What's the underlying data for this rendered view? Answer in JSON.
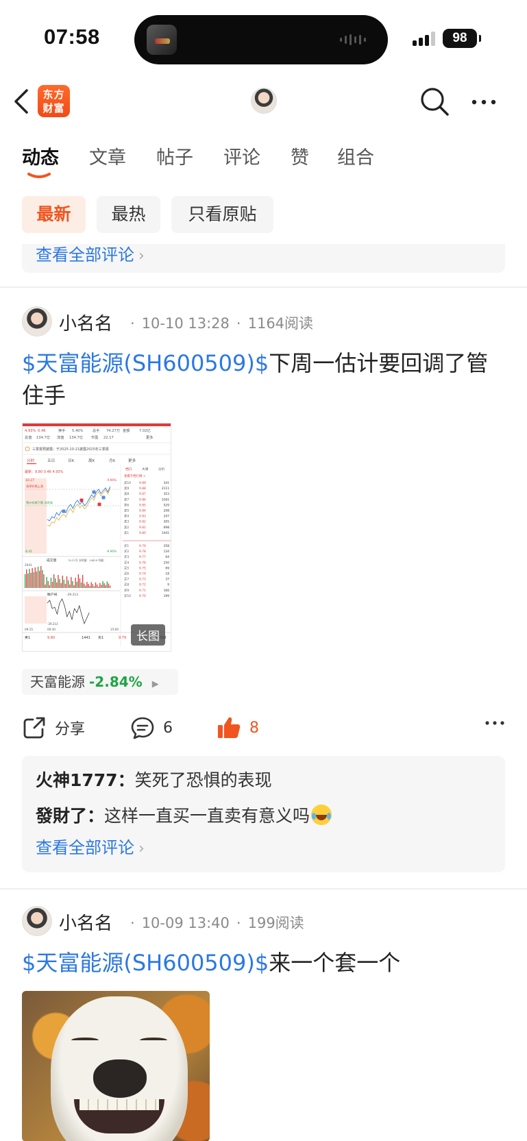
{
  "status_bar": {
    "time": "07:58",
    "battery": "98"
  },
  "nav": {
    "logo_line1": "东方",
    "logo_line2": "财富"
  },
  "tabs": [
    {
      "label": "动态",
      "active": true
    },
    {
      "label": "文章",
      "active": false
    },
    {
      "label": "帖子",
      "active": false
    },
    {
      "label": "评论",
      "active": false
    },
    {
      "label": "赞",
      "active": false
    },
    {
      "label": "组合",
      "active": false
    }
  ],
  "filters": [
    {
      "label": "最新",
      "active": true
    },
    {
      "label": "最热",
      "active": false
    },
    {
      "label": "只看原贴",
      "active": false
    }
  ],
  "prev_card": {
    "view_all": "查看全部评论"
  },
  "posts": [
    {
      "author": "小名名",
      "date": "10-10 13:28",
      "reads": "1164阅读",
      "tag": "$天富能源(SH600509)$",
      "text": "下周一估计要回调了管住手",
      "image_badge": "长图",
      "screenshot": {
        "header_row1": [
          "4.93%",
          "0.46",
          "换手",
          "5.40%",
          "总手",
          "74.27万",
          "金额",
          "7.02亿"
        ],
        "header_row2": [
          "总值",
          "134.7亿",
          "流值",
          "134.7亿",
          "市盈",
          "22.17",
          "更多"
        ],
        "notice": "三季报预披露：于2025-10-21披露2025年三季报",
        "tabs": [
          "分时",
          "五日",
          "日K",
          "周K",
          "月K",
          "更多"
        ],
        "price_line": "最新：9.80 0.46 4.93%",
        "side_tabs": [
          "档口",
          "大单",
          "分价"
        ],
        "side_link": "查看千档行情 >",
        "sell_levels": [
          [
            "卖10",
            "9.89",
            "341"
          ],
          [
            "卖9",
            "9.88",
            "2111"
          ],
          [
            "卖8",
            "9.87",
            "353"
          ],
          [
            "卖7",
            "9.86",
            "3161"
          ],
          [
            "卖6",
            "9.85",
            "529"
          ],
          [
            "卖5",
            "9.84",
            "208"
          ],
          [
            "卖4",
            "9.83",
            "247"
          ],
          [
            "卖3",
            "9.82",
            "305"
          ],
          [
            "卖2",
            "9.81",
            "698"
          ],
          [
            "卖1",
            "9.80",
            "1441"
          ]
        ],
        "buy_levels": [
          [
            "买1",
            "9.79",
            "358"
          ],
          [
            "买2",
            "9.78",
            "134"
          ],
          [
            "买3",
            "9.77",
            "64"
          ],
          [
            "买4",
            "9.76",
            "250"
          ],
          [
            "买5",
            "9.75",
            "69"
          ],
          [
            "买6",
            "9.74",
            "18"
          ],
          [
            "买7",
            "9.73",
            "37"
          ],
          [
            "买8",
            "9.72",
            "9"
          ],
          [
            "买9",
            "9.71",
            "166"
          ],
          [
            "买10",
            "9.70",
            "199"
          ]
        ],
        "price_top": "10.27",
        "price_bottom": "8.41",
        "pct_top": "9.96%",
        "pct_bottom": "-9.96%",
        "volume_label": "成交量",
        "volume_info": "74.27万 分时量：14819 均量：",
        "volume_max": "2041",
        "flow_label": "散户线",
        "flow_value": "-29.213",
        "flow_min": "-29.213",
        "time_start": "09:30",
        "time_end": "15:00",
        "footer": [
          "卖1",
          "9.80",
          "1441",
          "买1",
          "9.79",
          "358"
        ],
        "annotation1": "涨停价格上涨",
        "annotation2": "预计价格下跌 及时卖",
        "left_time": "09:15"
      },
      "stock_name": "天富能源",
      "stock_change": "-2.84%",
      "share_label": "分享",
      "comment_count": "6",
      "like_count": "8",
      "comments": [
        {
          "user": "火神1777：",
          "text": "笑死了恐惧的表现"
        },
        {
          "user": "發財了：",
          "text": "这样一直买一直卖有意义吗"
        }
      ],
      "view_all": "查看全部评论"
    },
    {
      "author": "小名名",
      "date": "10-09 13:40",
      "reads": "199阅读",
      "tag": "$天富能源(SH600509)$",
      "text": "来一个套一个"
    }
  ],
  "colors": {
    "accent": "#f2541e",
    "link": "#2b78e4",
    "down": "#1fa545",
    "up": "#e03a3a"
  }
}
